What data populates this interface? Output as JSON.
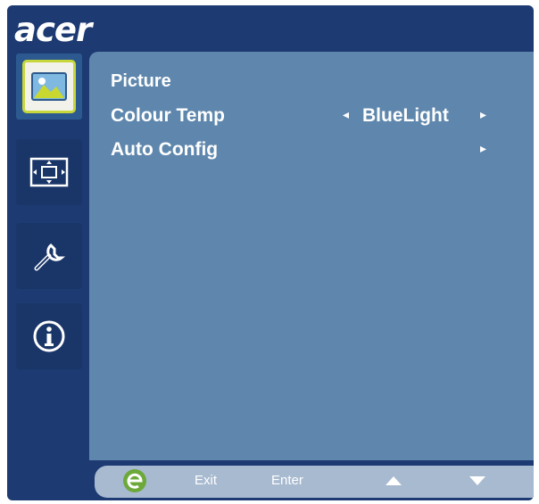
{
  "brand": {
    "logo_text": "acer"
  },
  "sidebar": {
    "tabs": [
      {
        "id": "picture",
        "icon": "picture-icon",
        "active": true
      },
      {
        "id": "position",
        "icon": "position-icon",
        "active": false
      },
      {
        "id": "settings",
        "icon": "settings-wrench-icon",
        "active": false
      },
      {
        "id": "information",
        "icon": "info-icon",
        "active": false
      }
    ]
  },
  "panel": {
    "title": "Picture",
    "rows": [
      {
        "label": "Colour Temp",
        "left_arrow": "◂",
        "value": "BlueLight",
        "right_arrow": "▸"
      },
      {
        "label": "Auto Config",
        "right_arrow": "▸"
      }
    ]
  },
  "footer": {
    "logo_icon": "e-logo-icon",
    "exit_label": "Exit",
    "enter_label": "Enter",
    "up_icon": "up-arrow-icon",
    "down_icon": "down-arrow-icon"
  },
  "colors": {
    "frame": "#1d3a72",
    "panel": "#5f87ad",
    "footer": "#a8bad0",
    "active_highlight": "#c7d63a",
    "text": "#ffffff"
  }
}
